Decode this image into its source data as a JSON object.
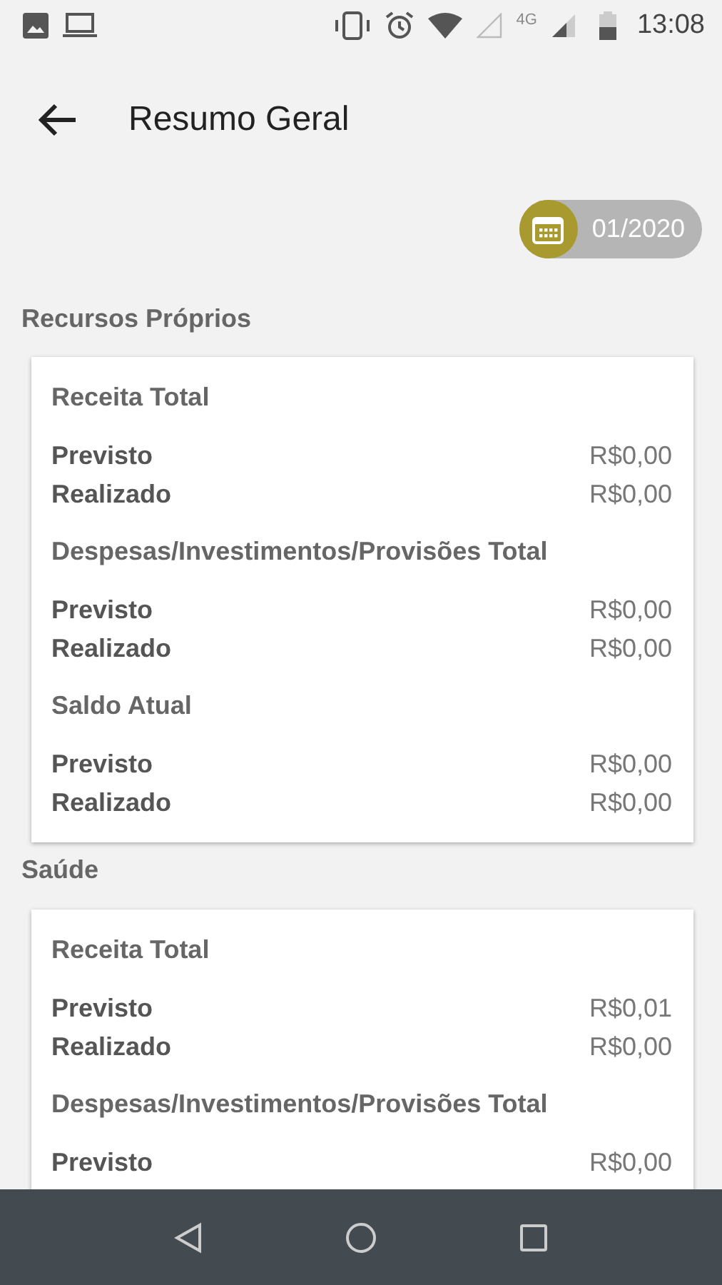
{
  "status_bar": {
    "network_label": "4G",
    "time": "13:08"
  },
  "toolbar": {
    "title": "Resumo Geral"
  },
  "period": {
    "label": "01/2020"
  },
  "sections": [
    {
      "title": "Recursos Próprios",
      "groups": [
        {
          "title": "Receita Total",
          "rows": [
            {
              "label": "Previsto",
              "value": "R$0,00"
            },
            {
              "label": "Realizado",
              "value": "R$0,00"
            }
          ]
        },
        {
          "title": "Despesas/Investimentos/Provisões Total",
          "rows": [
            {
              "label": "Previsto",
              "value": "R$0,00"
            },
            {
              "label": "Realizado",
              "value": "R$0,00"
            }
          ]
        },
        {
          "title": "Saldo Atual",
          "rows": [
            {
              "label": "Previsto",
              "value": "R$0,00"
            },
            {
              "label": "Realizado",
              "value": "R$0,00"
            }
          ]
        }
      ]
    },
    {
      "title": "Saúde",
      "groups": [
        {
          "title": "Receita Total",
          "rows": [
            {
              "label": "Previsto",
              "value": "R$0,01"
            },
            {
              "label": "Realizado",
              "value": "R$0,00"
            }
          ]
        },
        {
          "title": "Despesas/Investimentos/Provisões Total",
          "rows": [
            {
              "label": "Previsto",
              "value": "R$0,00"
            }
          ]
        }
      ]
    }
  ]
}
